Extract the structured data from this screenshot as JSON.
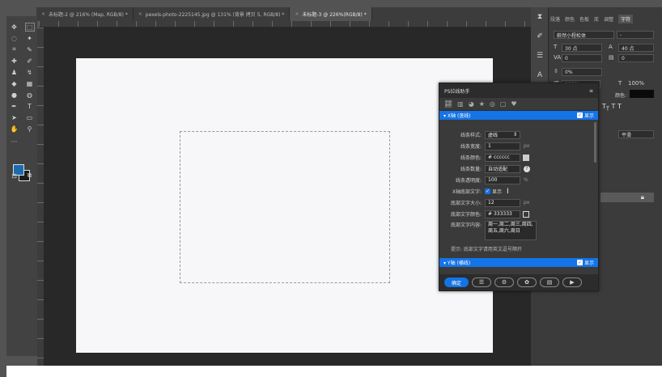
{
  "tabs": [
    {
      "label": "未标题-2 @ 216% (Map, RGB/8) *",
      "active": false
    },
    {
      "label": "pexels-photo-2225145.jpg @ 131% (背景 拷贝 5, RGB/8) *",
      "active": false
    },
    {
      "label": "未标题-3 @ 226%(RGB/8) *",
      "active": true
    }
  ],
  "right_panel": {
    "tabs": [
      "段落",
      "颜色",
      "色板",
      "库",
      "调整",
      "字符"
    ],
    "font_name": "蔚然小程松体",
    "font_size": "30 点",
    "leading": "40 点",
    "kerning": "0",
    "tracking": "0",
    "scale_pct": "0%",
    "vert_scale": "100%",
    "horiz_scale": "100%",
    "color_label": "颜色:",
    "aa": "平滑"
  },
  "plugin": {
    "title": "PS拉线助手",
    "x_section": "X轴 (竖线)",
    "y_section": "Y轴 (横线)",
    "show_label": "显示",
    "fields": {
      "line_style_label": "线条样式:",
      "line_style_value": "虚线",
      "line_width_label": "线条宽度:",
      "line_width_value": "1",
      "line_width_unit": "px",
      "line_color_label": "线条颜色:",
      "line_color_value": "cccccc",
      "line_count_label": "线条数量:",
      "line_count_value": "自动适配",
      "opacity_label": "线条透明度:",
      "opacity_value": "100",
      "opacity_unit": "%",
      "bottom_text_label": "X轴底部文字:",
      "bottom_text_show": "显示",
      "font_size_label": "底部文字大小:",
      "font_size_value": "12",
      "font_size_unit": "px",
      "text_color_label": "底部文字颜色:",
      "text_color_value": "333333",
      "text_content_label": "底部文字内容:",
      "text_content_value": "周一,周二,周三,周四,周五,周六,周日"
    },
    "tip": "提示:  底部文字请用英文逗号隔开",
    "confirm": "确定",
    "colors": {
      "accent": "#1473e6"
    }
  }
}
